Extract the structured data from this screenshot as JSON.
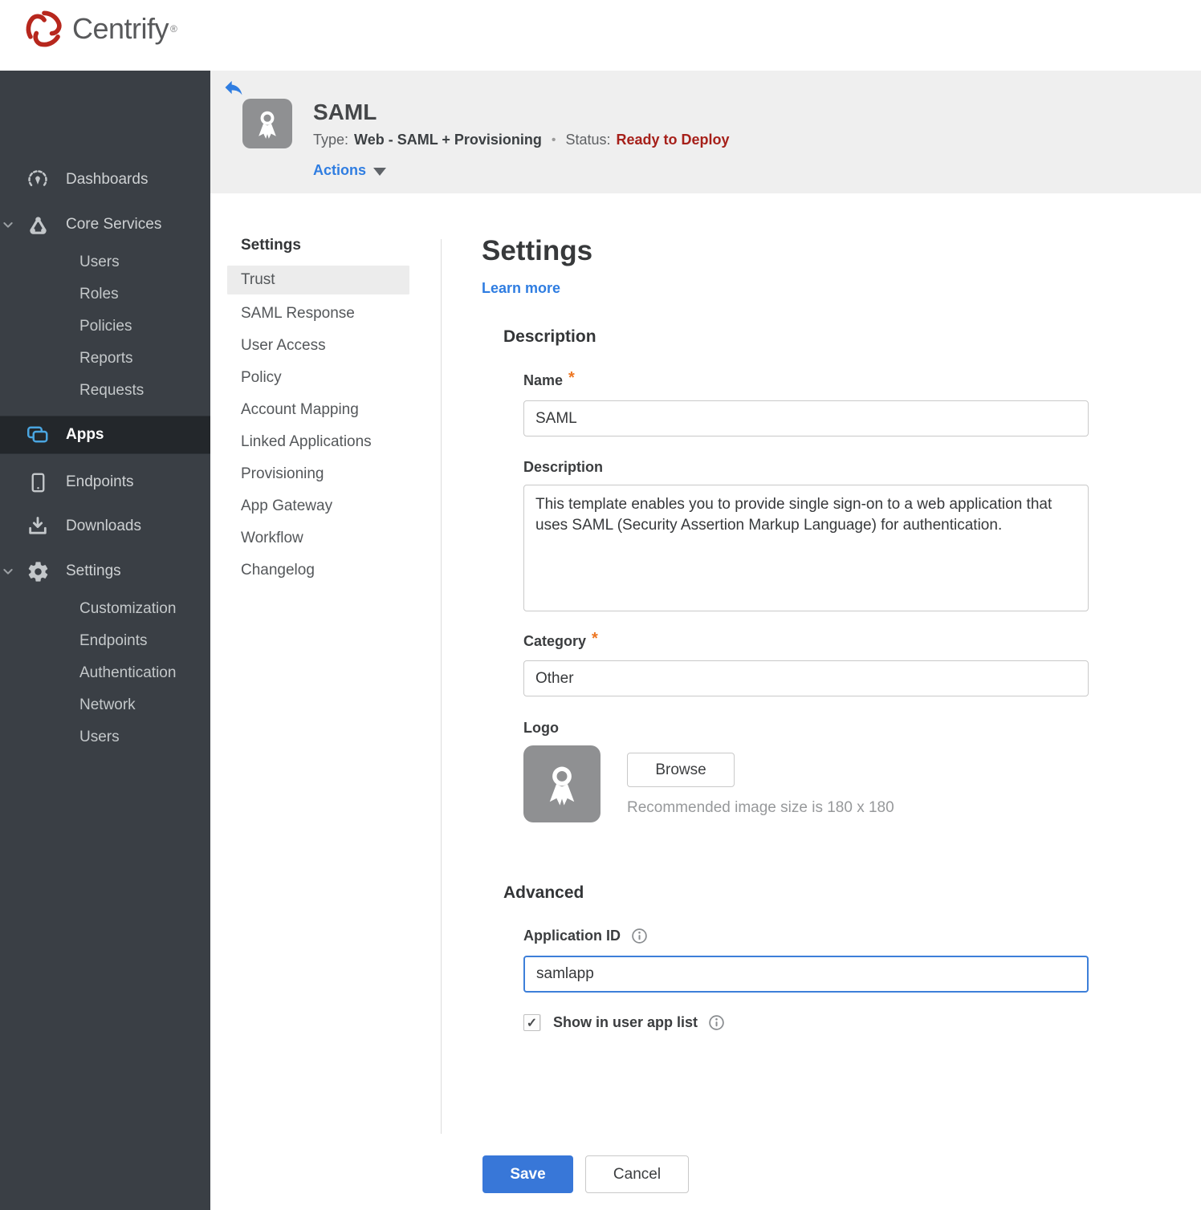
{
  "brand": {
    "name": "Centrify",
    "trademark": "®"
  },
  "sidebar": {
    "dashboards": "Dashboards",
    "core_services": "Core Services",
    "core_children": [
      "Users",
      "Roles",
      "Policies",
      "Reports",
      "Requests"
    ],
    "apps": "Apps",
    "endpoints": "Endpoints",
    "downloads": "Downloads",
    "settings": "Settings",
    "settings_children": [
      "Customization",
      "Endpoints",
      "Authentication",
      "Network",
      "Users"
    ]
  },
  "header": {
    "title": "SAML",
    "type_label": "Type:",
    "type_value": "Web - SAML + Provisioning",
    "separator": "•",
    "status_label": "Status:",
    "status_value": "Ready to Deploy",
    "actions_label": "Actions"
  },
  "subnav": {
    "heading": "Settings",
    "selected": "Trust",
    "items": [
      "Trust",
      "SAML Response",
      "User Access",
      "Policy",
      "Account Mapping",
      "Linked Applications",
      "Provisioning",
      "App Gateway",
      "Workflow",
      "Changelog"
    ]
  },
  "main": {
    "title": "Settings",
    "learn_more": "Learn more",
    "required_marker": "*",
    "description": {
      "heading": "Description",
      "name_label": "Name",
      "name_value": "SAML",
      "description_label": "Description",
      "description_value": "This template enables you to provide single sign-on to a web application that uses SAML (Security Assertion Markup Language) for authentication.",
      "category_label": "Category",
      "category_value": "Other",
      "logo_label": "Logo",
      "browse_label": "Browse",
      "logo_hint": "Recommended image size is 180 x 180"
    },
    "advanced": {
      "heading": "Advanced",
      "app_id_label": "Application ID",
      "app_id_value": "samlapp",
      "show_in_app_list_label": "Show in user app list",
      "show_in_app_list_checked": true
    },
    "footer": {
      "save_label": "Save",
      "cancel_label": "Cancel"
    }
  },
  "icons": {
    "check": "✓"
  },
  "colors": {
    "brand_red": "#b7271d",
    "accent_blue": "#2f7de1",
    "save_blue": "#3877d8",
    "status_red": "#a6201a",
    "apps_icon_blue": "#4aa5e0",
    "sidebar_bg": "#3a3f45",
    "header_band_bg": "#efefef"
  }
}
